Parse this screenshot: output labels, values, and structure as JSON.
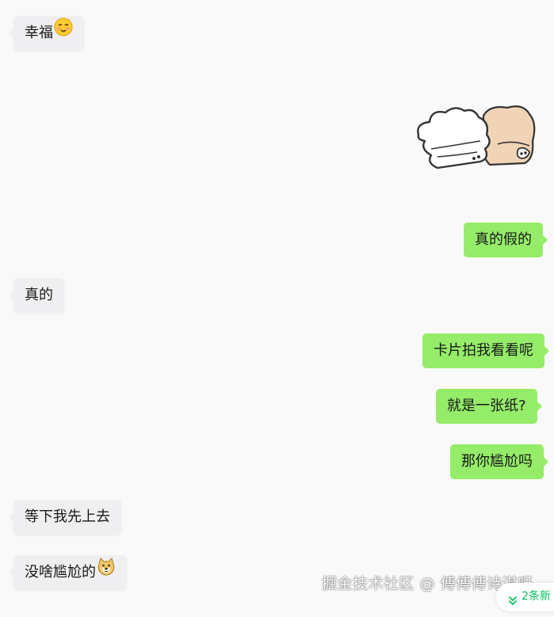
{
  "messages": [
    {
      "text": "幸福",
      "side": "left",
      "emoji": "blushing-face-emoji"
    },
    {
      "text": "真的假的",
      "side": "right"
    },
    {
      "text": "真的",
      "side": "left"
    },
    {
      "text": "卡片拍我看看呢",
      "side": "right"
    },
    {
      "text": "就是一张纸?",
      "side": "right"
    },
    {
      "text": "那你尴尬吗",
      "side": "right"
    },
    {
      "text": "等下我先上去",
      "side": "left"
    },
    {
      "text": "没啥尴尬的",
      "side": "left",
      "emoji": "doge-emoji"
    }
  ],
  "sticker": {
    "icon": "bunny-and-bear-sticker"
  },
  "watermark": "掘金技术社区 @ 傅傅傅诗淇呀",
  "new_messages": {
    "label": "2条新",
    "icon": "double-chevron-down-icon"
  },
  "colors": {
    "background": "#f9f9f9",
    "incoming_bubble": "#efeff1",
    "outgoing_bubble": "#95ec69",
    "accent": "#07c160"
  }
}
